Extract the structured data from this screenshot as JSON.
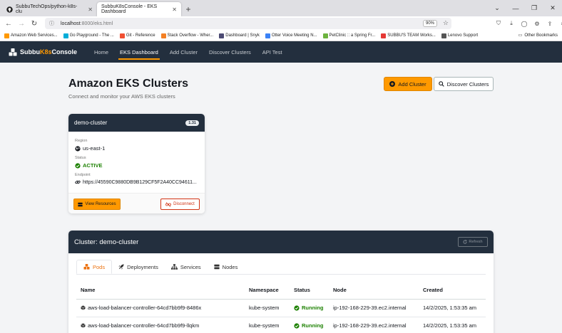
{
  "browser": {
    "tabs": [
      {
        "title": "SubbuTechOps/python-k8s-clu",
        "active": false,
        "icon": "github-icon"
      },
      {
        "title": "SubbuK8sConsole - EKS Dashboard",
        "active": true,
        "icon": "page-icon"
      }
    ],
    "url_host": "localhost",
    "url_rest": ":8000/eks.html",
    "zoom": "90%",
    "bookmarks": [
      {
        "label": "Amazon Web Services...",
        "color": "#ff9900"
      },
      {
        "label": "Go Playground - The ...",
        "color": "#00add8"
      },
      {
        "label": "Git - Reference",
        "color": "#f05032"
      },
      {
        "label": "Stack Overflow - Wher...",
        "color": "#f48024"
      },
      {
        "label": "Dashboard | Snyk",
        "color": "#4c4a73"
      },
      {
        "label": "Otter Voice Meeting N...",
        "color": "#3b82f6"
      },
      {
        "label": "PetClinic :: a Spring Fr...",
        "color": "#6db33f"
      },
      {
        "label": "SUBBU'S TEAM Works...",
        "color": "#e53935"
      },
      {
        "label": "Lenovo Support",
        "color": "#555555"
      }
    ],
    "other_bookmarks": "Other Bookmarks"
  },
  "app": {
    "brand_prefix": "Subbu",
    "brand_k8s": "K8s",
    "brand_suffix": "Console",
    "nav": [
      "Home",
      "EKS Dashboard",
      "Add Cluster",
      "Discover Clusters",
      "API Test"
    ],
    "active_nav": 1
  },
  "page": {
    "title": "Amazon EKS Clusters",
    "subtitle": "Connect and monitor your AWS EKS clusters",
    "add_cluster_label": "Add Cluster",
    "discover_label": "Discover Clusters"
  },
  "cluster_card": {
    "name": "demo-cluster",
    "version": "1.31",
    "region_label": "Region",
    "region": "us-east-1",
    "status_label": "Status",
    "status": "ACTIVE",
    "endpoint_label": "Endpoint",
    "endpoint": "https://45590C9880DB9B129CF5F2A40CC94611...",
    "view_resources": "View Resources",
    "disconnect": "Disconnect"
  },
  "cluster_detail": {
    "title": "Cluster: demo-cluster",
    "refresh": "Refresh",
    "tabs": [
      "Pods",
      "Deployments",
      "Services",
      "Nodes"
    ],
    "active_tab": 0,
    "columns": [
      "Name",
      "Namespace",
      "Status",
      "Node",
      "Created"
    ],
    "rows": [
      {
        "name": "aws-load-balancer-controller-64cd7bb9f9-8486x",
        "namespace": "kube-system",
        "status": "Running",
        "node": "ip-192-168-229-39.ec2.internal",
        "created": "14/2/2025, 1:53:35 am"
      },
      {
        "name": "aws-load-balancer-controller-64cd7bb9f9-llqkm",
        "namespace": "kube-system",
        "status": "Running",
        "node": "ip-192-168-229-39.ec2.internal",
        "created": "14/2/2025, 1:53:35 am"
      }
    ]
  },
  "colors": {
    "accent": "#ff9900",
    "nav_bg": "#232f3e",
    "success": "#1d8102",
    "danger": "#d13212"
  }
}
